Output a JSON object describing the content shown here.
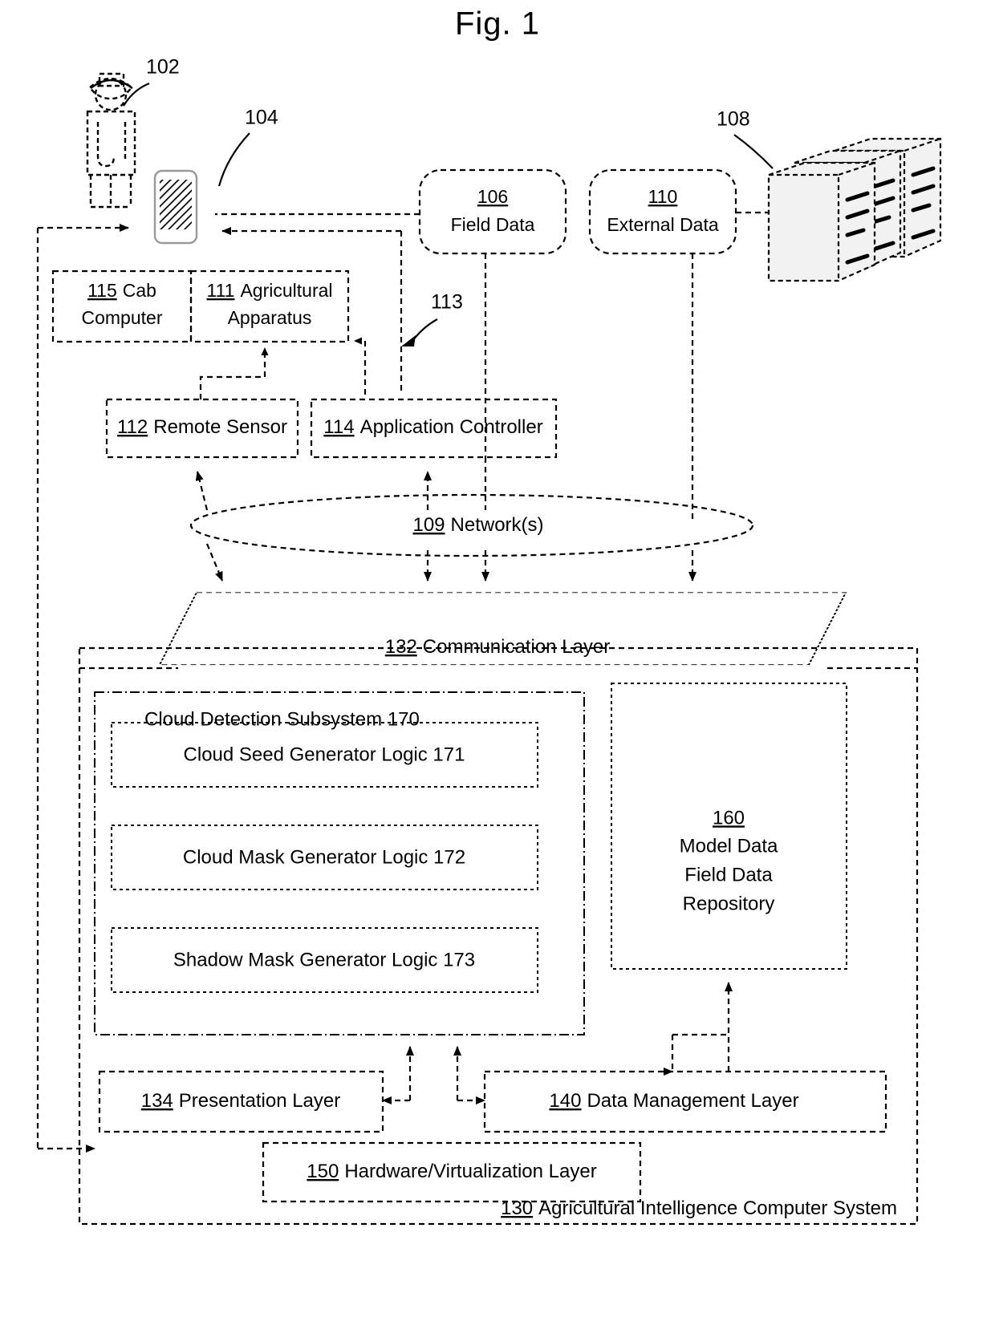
{
  "figure": {
    "title": "Fig. 1"
  },
  "callouts": {
    "user_ref": "102",
    "device_ref": "104",
    "servers_ref": "108",
    "link_113_ref": "113"
  },
  "nodes": {
    "field_data": {
      "ref": "106",
      "label": "Field Data"
    },
    "external_data": {
      "ref": "110",
      "label": "External Data"
    },
    "cab_computer": {
      "ref": "115",
      "label": "Cab",
      "label2": "Computer",
      "full": "115 Cab Computer"
    },
    "agricultural_apparatus": {
      "ref": "111",
      "label": "Agricultural",
      "label2": "Apparatus",
      "full": "111 Agricultural Apparatus"
    },
    "remote_sensor": {
      "ref": "112",
      "label": "Remote Sensor"
    },
    "application_controller": {
      "ref": "114",
      "label": "Application Controller"
    },
    "network": {
      "ref": "109",
      "label": "Network(s)"
    },
    "communication_layer": {
      "ref": "132",
      "label": "Communication Layer"
    },
    "cloud_detection_subsystem": {
      "label": "Cloud Detection Subsystem 170"
    },
    "cloud_seed_generator": {
      "label": "Cloud Seed Generator Logic 171"
    },
    "cloud_mask_generator": {
      "label": "Cloud Mask Generator Logic 172"
    },
    "shadow_mask_generator": {
      "label": "Shadow Mask Generator Logic 173"
    },
    "repository": {
      "ref": "160",
      "line1": "Model Data",
      "line2": "Field Data",
      "line3": "Repository"
    },
    "presentation_layer": {
      "ref": "134",
      "label": "Presentation Layer"
    },
    "data_management_layer": {
      "ref": "140",
      "label": "Data Management Layer"
    },
    "hardware_virtualization_layer": {
      "ref": "150",
      "label": "Hardware/Virtualization  Layer"
    },
    "agricultural_intelligence_computer_system": {
      "ref": "130",
      "label": "Agricultural Intelligence Computer System"
    }
  },
  "icons": {
    "user": "person-icon",
    "mobile_device": "mobile-device-icon",
    "servers": "server-stack-icon"
  },
  "colors": {
    "stroke": "#000000",
    "background": "#ffffff",
    "server_fill": "#f2f2f2"
  }
}
